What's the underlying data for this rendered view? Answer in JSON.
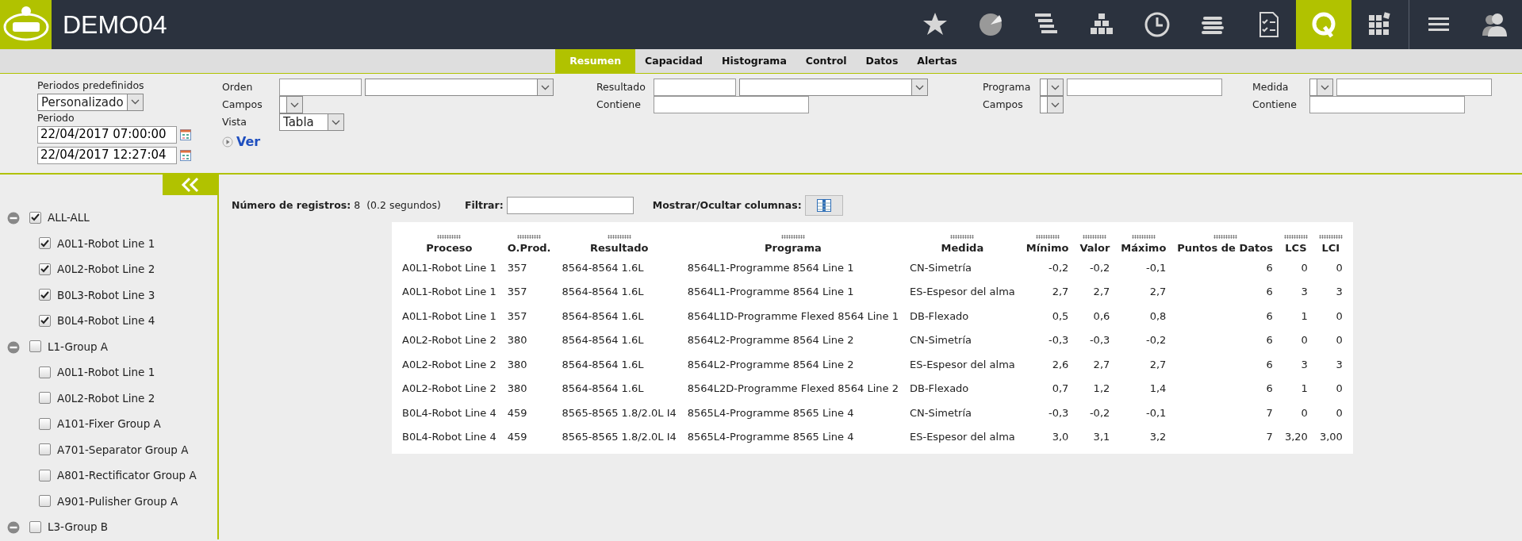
{
  "app": {
    "title": "DEMO04"
  },
  "toolbar_icons": [
    {
      "kind": "star",
      "selected": false
    },
    {
      "kind": "pie",
      "selected": false
    },
    {
      "kind": "bars",
      "selected": false
    },
    {
      "kind": "blocks",
      "selected": false
    },
    {
      "kind": "clock",
      "selected": false
    },
    {
      "kind": "coins",
      "selected": false
    },
    {
      "kind": "checklist",
      "selected": false
    },
    {
      "kind": "q",
      "selected": true
    },
    {
      "kind": "grid",
      "selected": false
    },
    {
      "kind": "menu",
      "selected": false
    },
    {
      "kind": "user",
      "selected": false
    }
  ],
  "tabs": [
    {
      "label": "Resumen",
      "selected": true
    },
    {
      "label": "Capacidad",
      "selected": false
    },
    {
      "label": "Histograma",
      "selected": false
    },
    {
      "label": "Control",
      "selected": false
    },
    {
      "label": "Datos",
      "selected": false
    },
    {
      "label": "Alertas",
      "selected": false
    }
  ],
  "period_panel": {
    "preset_label": "Periodos predefinidos",
    "preset_value": "Personalizado",
    "period_label": "Periodo",
    "start": "22/04/2017 07:00:00",
    "end": "22/04/2017 12:27:04"
  },
  "filter_groups": [
    {
      "rows": [
        {
          "label": "Orden",
          "controls": [
            {
              "kind": "field"
            },
            {
              "kind": "wide-select"
            }
          ]
        },
        {
          "label": "Campos",
          "controls": [
            {
              "kind": "mini-select"
            }
          ]
        },
        {
          "label": "Vista",
          "controls": [
            {
              "kind": "select",
              "value": "Tabla"
            }
          ]
        }
      ],
      "link": "Ver"
    },
    {
      "rows": [
        {
          "label": "Resultado",
          "controls": [
            {
              "kind": "field"
            },
            {
              "kind": "wide-select"
            }
          ]
        },
        {
          "label": "Contiene",
          "controls": [
            {
              "kind": "wide-field"
            }
          ]
        }
      ]
    },
    {
      "rows": [
        {
          "label": "Programa",
          "controls": [
            {
              "kind": "mini-select"
            },
            {
              "kind": "wide-field"
            }
          ]
        },
        {
          "label": "Campos",
          "controls": [
            {
              "kind": "mini-select"
            }
          ]
        }
      ]
    },
    {
      "rows": [
        {
          "label": "Medida",
          "controls": [
            {
              "kind": "mini-select"
            },
            {
              "kind": "wide-field"
            }
          ]
        },
        {
          "label": "Contiene",
          "controls": [
            {
              "kind": "wide-field"
            }
          ]
        }
      ]
    }
  ],
  "tree": [
    {
      "label": "ALL-ALL",
      "checked": true,
      "expanded": true,
      "children": [
        {
          "label": "A0L1-Robot Line 1",
          "checked": true
        },
        {
          "label": "A0L2-Robot Line 2",
          "checked": true
        },
        {
          "label": "B0L3-Robot Line 3",
          "checked": true
        },
        {
          "label": "B0L4-Robot Line 4",
          "checked": true
        }
      ]
    },
    {
      "label": "L1-Group A",
      "checked": false,
      "expanded": true,
      "children": [
        {
          "label": "A0L1-Robot Line 1",
          "checked": false
        },
        {
          "label": "A0L2-Robot Line 2",
          "checked": false
        },
        {
          "label": "A101-Fixer Group A",
          "checked": false
        },
        {
          "label": "A701-Separator Group A",
          "checked": false
        },
        {
          "label": "A801-Rectificator Group A",
          "checked": false
        },
        {
          "label": "A901-Pulisher Group A",
          "checked": false
        }
      ]
    },
    {
      "label": "L3-Group B",
      "checked": false,
      "expanded": true
    }
  ],
  "summary": {
    "count_label": "Número de registros:",
    "count": "8",
    "time": "(0.2 segundos)",
    "filter_label": "Filtrar:",
    "columns_label": "Mostrar/Ocultar columnas:"
  },
  "table": {
    "columns": [
      {
        "label": "Proceso",
        "numeric": false
      },
      {
        "label": "O.Prod.",
        "numeric": false
      },
      {
        "label": "Resultado",
        "numeric": false
      },
      {
        "label": "Programa",
        "numeric": false
      },
      {
        "label": "Medida",
        "numeric": false
      },
      {
        "label": "Mínimo",
        "numeric": true
      },
      {
        "label": "Valor",
        "numeric": true
      },
      {
        "label": "Máximo",
        "numeric": true
      },
      {
        "label": "Puntos de Datos",
        "numeric": true
      },
      {
        "label": "LCS",
        "numeric": true
      },
      {
        "label": "LCI",
        "numeric": true
      }
    ],
    "rows": [
      [
        "A0L1-Robot Line 1",
        "357",
        "8564-8564 1.6L",
        "8564L1-Programme 8564 Line 1",
        "CN-Simetría",
        "-0,2",
        "-0,2",
        "-0,1",
        "6",
        "0",
        "0"
      ],
      [
        "A0L1-Robot Line 1",
        "357",
        "8564-8564 1.6L",
        "8564L1-Programme 8564 Line 1",
        "ES-Espesor del alma",
        "2,7",
        "2,7",
        "2,7",
        "6",
        "3",
        "3"
      ],
      [
        "A0L1-Robot Line 1",
        "357",
        "8564-8564 1.6L",
        "8564L1D-Programme Flexed 8564 Line 1",
        "DB-Flexado",
        "0,5",
        "0,6",
        "0,8",
        "6",
        "1",
        "0"
      ],
      [
        "A0L2-Robot Line 2",
        "380",
        "8564-8564 1.6L",
        "8564L2-Programme 8564 Line 2",
        "CN-Simetría",
        "-0,3",
        "-0,3",
        "-0,2",
        "6",
        "0",
        "0"
      ],
      [
        "A0L2-Robot Line 2",
        "380",
        "8564-8564 1.6L",
        "8564L2-Programme 8564 Line 2",
        "ES-Espesor del alma",
        "2,6",
        "2,7",
        "2,7",
        "6",
        "3",
        "3"
      ],
      [
        "A0L2-Robot Line 2",
        "380",
        "8564-8564 1.6L",
        "8564L2D-Programme Flexed 8564 Line 2",
        "DB-Flexado",
        "0,7",
        "1,2",
        "1,4",
        "6",
        "1",
        "0"
      ],
      [
        "B0L4-Robot Line 4",
        "459",
        "8565-8565 1.8/2.0L I4",
        "8565L4-Programme 8565 Line 4",
        "CN-Simetría",
        "-0,3",
        "-0,2",
        "-0,1",
        "7",
        "0",
        "0"
      ],
      [
        "B0L4-Robot Line 4",
        "459",
        "8565-8565 1.8/2.0L I4",
        "8565L4-Programme 8565 Line 4",
        "ES-Espesor del alma",
        "3,0",
        "3,1",
        "3,2",
        "7",
        "3,20",
        "3,00"
      ]
    ]
  }
}
